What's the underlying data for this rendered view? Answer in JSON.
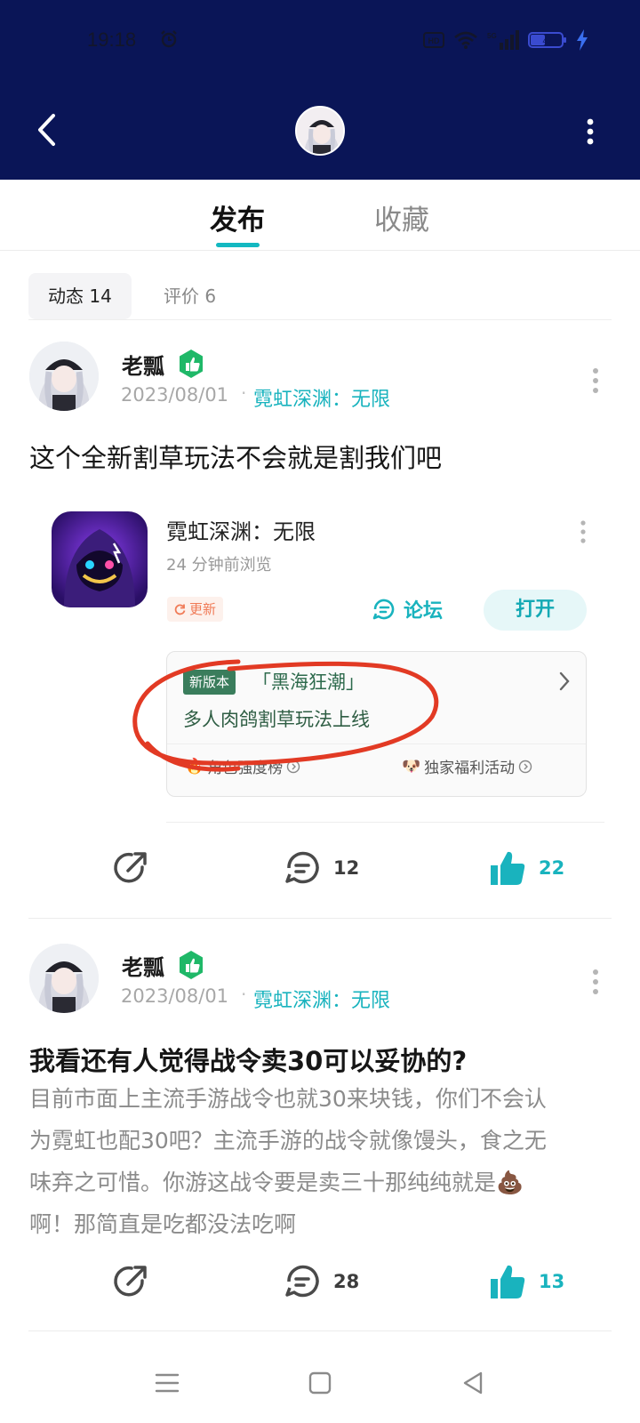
{
  "status_bar": {
    "time": "19:18",
    "battery": "47"
  },
  "tabs": [
    {
      "label": "发布",
      "active": true
    },
    {
      "label": "收藏",
      "active": false
    }
  ],
  "filters": [
    {
      "label": "动态 14",
      "active": true
    },
    {
      "label": "评价 6",
      "active": false
    }
  ],
  "posts": [
    {
      "username": "老瓢",
      "date": "2023/08/01",
      "game": "霓虹深渊：无限",
      "title": "这个全新割草玩法不会就是割我们吧",
      "app_card": {
        "name": "霓虹深渊：无限",
        "viewed": "24 分钟前浏览",
        "update_tag": "更新",
        "forum_label": "论坛",
        "open_label": "打开",
        "promo": {
          "version_tag": "新版本",
          "event": "「黑海狂潮」",
          "headline": "多人肉鸽割草玩法上线",
          "link1": "角色强度榜",
          "link2": "独家福利活动"
        }
      },
      "comments": "12",
      "likes": "22"
    },
    {
      "username": "老瓢",
      "date": "2023/08/01",
      "game": "霓虹深渊：无限",
      "title": "我看还有人觉得战令卖30可以妥协的?",
      "body_lines": [
        "目前市面上主流手游战令也就30来块钱，你们不会认",
        "为霓虹也配30吧？主流手游的战令就像馒头，食之无",
        "味弃之可惜。你游这战令要是卖三十那纯纯就是💩",
        "啊！那简直是吃都没法吃啊"
      ],
      "comments": "28",
      "likes": "13"
    }
  ],
  "colors": {
    "header_bg": "#0a1557",
    "accent": "#19b3be",
    "badge_green": "#1fb868",
    "annotation_red": "#e23a24"
  }
}
